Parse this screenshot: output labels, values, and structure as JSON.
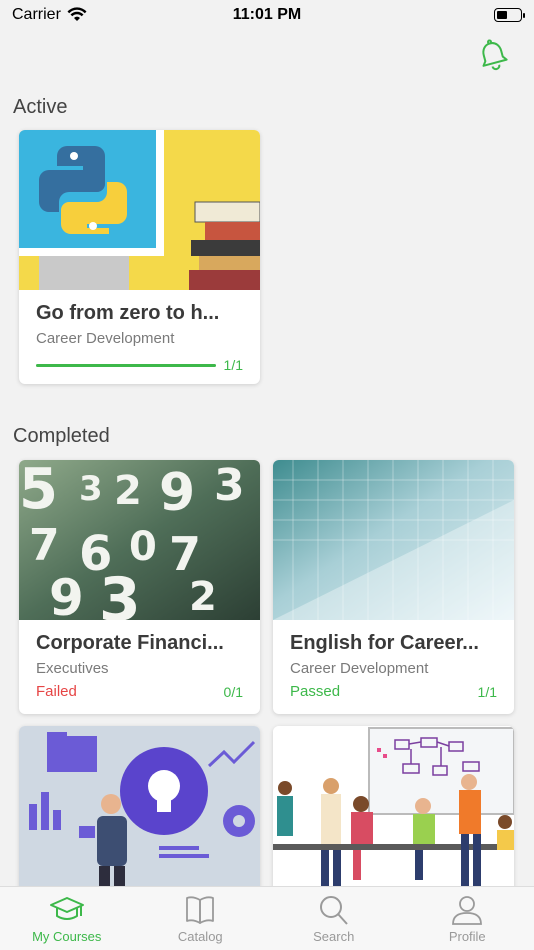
{
  "status_bar": {
    "carrier": "Carrier",
    "time": "11:01 PM",
    "icons": [
      "wifi-icon",
      "battery-icon"
    ]
  },
  "header": {
    "bell_icon": "bell-icon"
  },
  "sections": {
    "active_title": "Active",
    "completed_title": "Completed"
  },
  "active_courses": [
    {
      "title": "Go from zero to h...",
      "category": "Career Development",
      "count": "1/1",
      "progress": 1.0,
      "image": "python-monitor-books"
    }
  ],
  "completed_courses": [
    {
      "title": "Corporate Financi...",
      "category": "Executives",
      "status": "Failed",
      "count": "0/1",
      "image": "numbers-closeup"
    },
    {
      "title": "English for Career...",
      "category": "Career Development",
      "status": "Passed",
      "count": "1/1",
      "image": "blue-glass-building"
    },
    {
      "image": "lightbulb-business-illustration"
    },
    {
      "image": "team-whiteboard-illustration"
    }
  ],
  "tabbar": {
    "items": [
      {
        "label": "My Courses",
        "icon": "graduation-cap-icon",
        "active": true
      },
      {
        "label": "Catalog",
        "icon": "book-icon",
        "active": false
      },
      {
        "label": "Search",
        "icon": "search-icon",
        "active": false
      },
      {
        "label": "Profile",
        "icon": "person-icon",
        "active": false
      }
    ]
  },
  "colors": {
    "accent": "#3db84a",
    "failed": "#e64545",
    "background": "#f2f2f2"
  }
}
